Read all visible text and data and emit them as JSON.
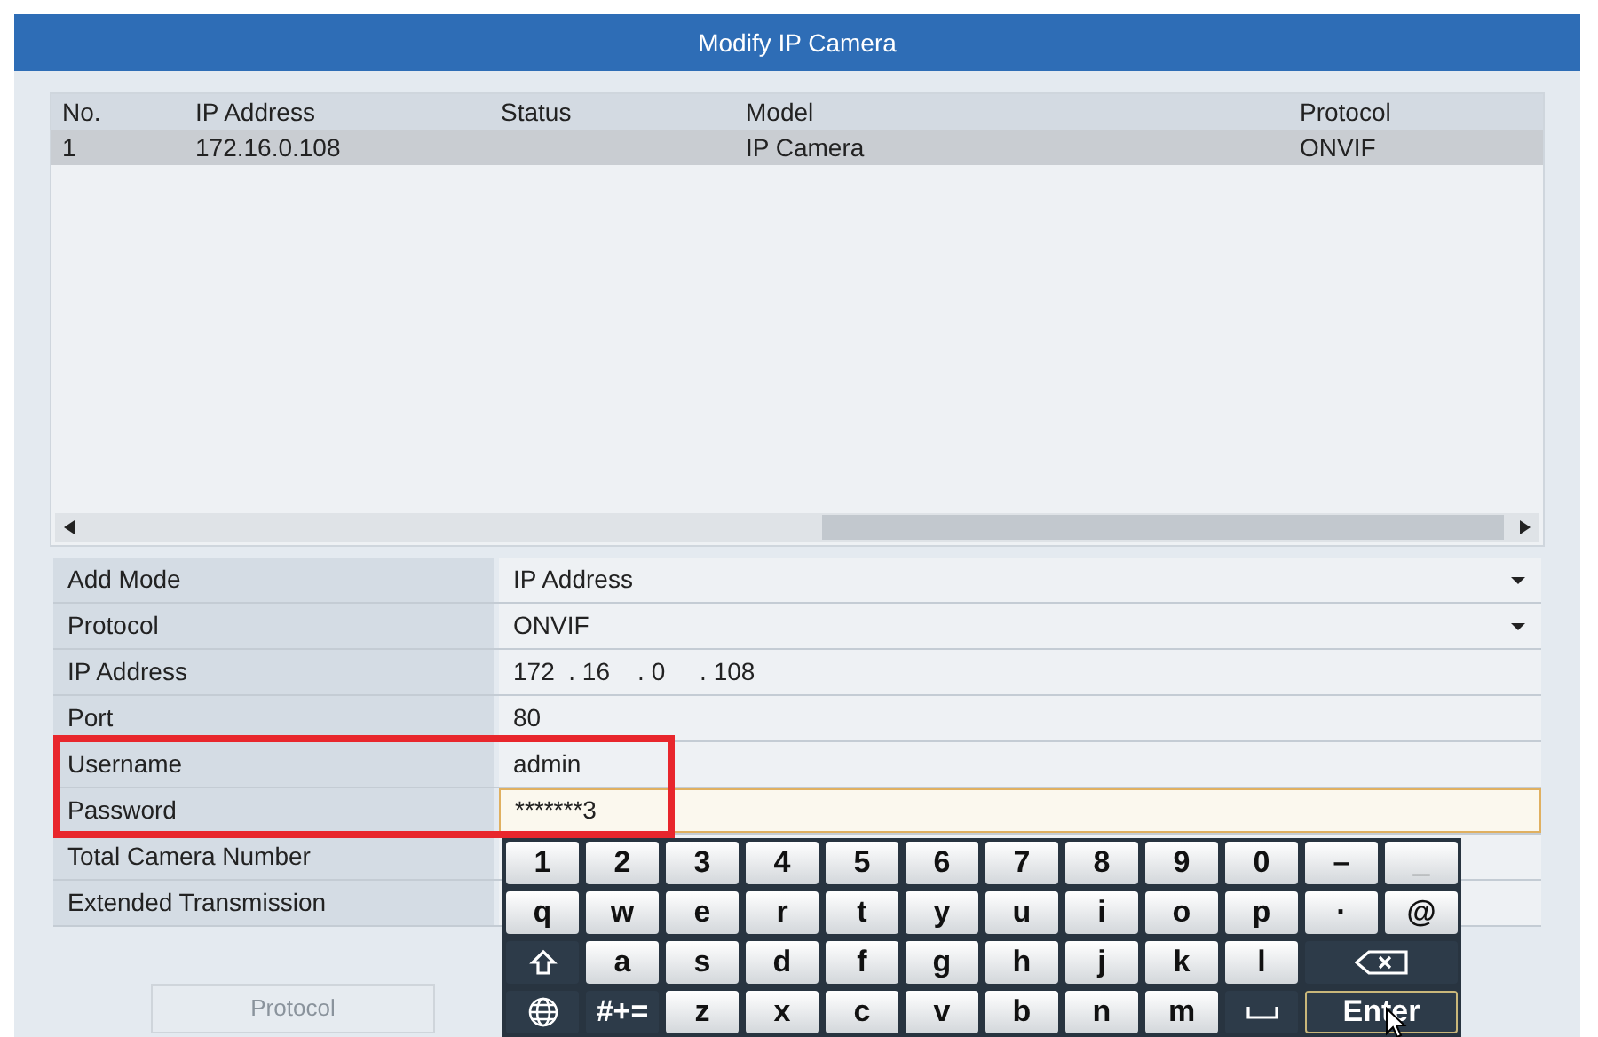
{
  "window": {
    "title": "Modify IP Camera"
  },
  "table": {
    "columns": [
      "No.",
      "IP Address",
      "Status",
      "Model",
      "Protocol"
    ],
    "rows": [
      {
        "cells": [
          "1",
          "172.16.0.108",
          "",
          "IP Camera",
          "ONVIF"
        ],
        "selected": true
      }
    ]
  },
  "form": [
    {
      "label": "Add Mode",
      "value": "IP Address",
      "kind": "select",
      "focused": false,
      "highlighted": false
    },
    {
      "label": "Protocol",
      "value": "ONVIF",
      "kind": "select",
      "focused": false,
      "highlighted": false
    },
    {
      "label": "IP Address",
      "value": "172  . 16    . 0     . 108",
      "kind": "text",
      "focused": false,
      "highlighted": false
    },
    {
      "label": "Port",
      "value": "80",
      "kind": "text",
      "focused": false,
      "highlighted": false
    },
    {
      "label": "Username",
      "value": "admin",
      "kind": "text",
      "focused": false,
      "highlighted": true
    },
    {
      "label": "Password",
      "value": "*******3",
      "kind": "text",
      "focused": true,
      "highlighted": true
    },
    {
      "label": "Total Camera Number",
      "kind": "text",
      "focused": false,
      "highlighted": false
    },
    {
      "label": "Extended Transmission",
      "kind": "text",
      "focused": false,
      "highlighted": false
    }
  ],
  "keyboard": [
    [
      {
        "kind": "char",
        "label": "1"
      },
      {
        "kind": "char",
        "label": "2"
      },
      {
        "kind": "char",
        "label": "3"
      },
      {
        "kind": "char",
        "label": "4"
      },
      {
        "kind": "char",
        "label": "5"
      },
      {
        "kind": "char",
        "label": "6"
      },
      {
        "kind": "char",
        "label": "7"
      },
      {
        "kind": "char",
        "label": "8"
      },
      {
        "kind": "char",
        "label": "9"
      },
      {
        "kind": "char",
        "label": "0"
      },
      {
        "kind": "char",
        "label": "–"
      },
      {
        "kind": "char",
        "label": "_"
      }
    ],
    [
      {
        "kind": "char",
        "label": "q"
      },
      {
        "kind": "char",
        "label": "w"
      },
      {
        "kind": "char",
        "label": "e"
      },
      {
        "kind": "char",
        "label": "r"
      },
      {
        "kind": "char",
        "label": "t"
      },
      {
        "kind": "char",
        "label": "y"
      },
      {
        "kind": "char",
        "label": "u"
      },
      {
        "kind": "char",
        "label": "i"
      },
      {
        "kind": "char",
        "label": "o"
      },
      {
        "kind": "char",
        "label": "p"
      },
      {
        "kind": "char",
        "label": "·"
      },
      {
        "kind": "char",
        "label": "@"
      }
    ],
    [
      {
        "kind": "shift"
      },
      {
        "kind": "char",
        "label": "a"
      },
      {
        "kind": "char",
        "label": "s"
      },
      {
        "kind": "char",
        "label": "d"
      },
      {
        "kind": "char",
        "label": "f"
      },
      {
        "kind": "char",
        "label": "g"
      },
      {
        "kind": "char",
        "label": "h"
      },
      {
        "kind": "char",
        "label": "j"
      },
      {
        "kind": "char",
        "label": "k"
      },
      {
        "kind": "char",
        "label": "l"
      },
      {
        "kind": "backspace"
      }
    ],
    [
      {
        "kind": "globe"
      },
      {
        "kind": "mode",
        "label": "#+="
      },
      {
        "kind": "char",
        "label": "z"
      },
      {
        "kind": "char",
        "label": "x"
      },
      {
        "kind": "char",
        "label": "c"
      },
      {
        "kind": "char",
        "label": "v"
      },
      {
        "kind": "char",
        "label": "b"
      },
      {
        "kind": "char",
        "label": "n"
      },
      {
        "kind": "char",
        "label": "m"
      },
      {
        "kind": "space"
      },
      {
        "kind": "enter",
        "label": "Enter"
      }
    ]
  ],
  "buttons": [
    {
      "label": "Protocol",
      "disabled": true
    }
  ]
}
